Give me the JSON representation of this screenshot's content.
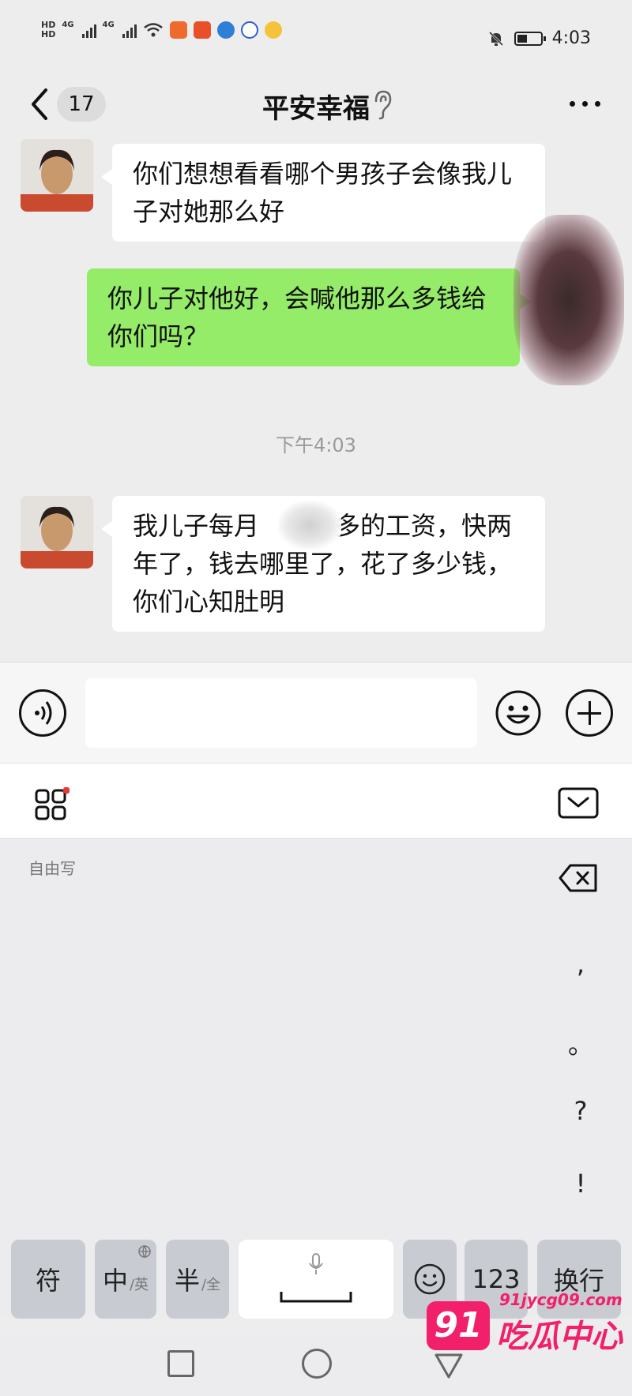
{
  "statusbar": {
    "hd_top": "HD",
    "hd_bottom": "HD",
    "net1": "4G",
    "net2": "4G",
    "time": "4:03"
  },
  "header": {
    "unread_count": "17",
    "title": "平安幸福"
  },
  "messages": [
    {
      "side": "left",
      "text": "你们想想看看哪个男孩子会像我儿子对她那么好"
    },
    {
      "side": "right",
      "text": "你儿子对他好，会喊他那么多钱给你们吗？"
    },
    {
      "side": "left",
      "text": "我儿子每月　　千多的工资，快两年了，钱去哪里了，花了多少钱，你们心知肚明"
    }
  ],
  "timestamp": "下午4:03",
  "keyboard": {
    "mode_label": "自由写",
    "punctuation": [
      ",",
      "。",
      "?",
      "!"
    ],
    "keys": {
      "symbol": "符",
      "chinese": "中",
      "chinese_sub": "/英",
      "half": "半",
      "half_sub": "/全",
      "numbers": "123",
      "newline": "换行"
    }
  },
  "watermark": {
    "badge": "91",
    "url": "91jycg09.com",
    "name": "吃瓜中心"
  },
  "colors": {
    "chat_bg": "#ededed",
    "sent_bubble": "#95ec69",
    "received_bubble": "#ffffff",
    "watermark": "#f21f6b"
  },
  "icons": [
    "back-chevron-icon",
    "ear-icon",
    "more-icon",
    "voice-icon",
    "emoji-icon",
    "plus-icon",
    "apps-grid-icon",
    "keyboard-collapse-icon",
    "delete-icon",
    "mic-icon",
    "emoji-key-icon",
    "nav-square-icon",
    "nav-circle-icon",
    "nav-back-icon"
  ]
}
